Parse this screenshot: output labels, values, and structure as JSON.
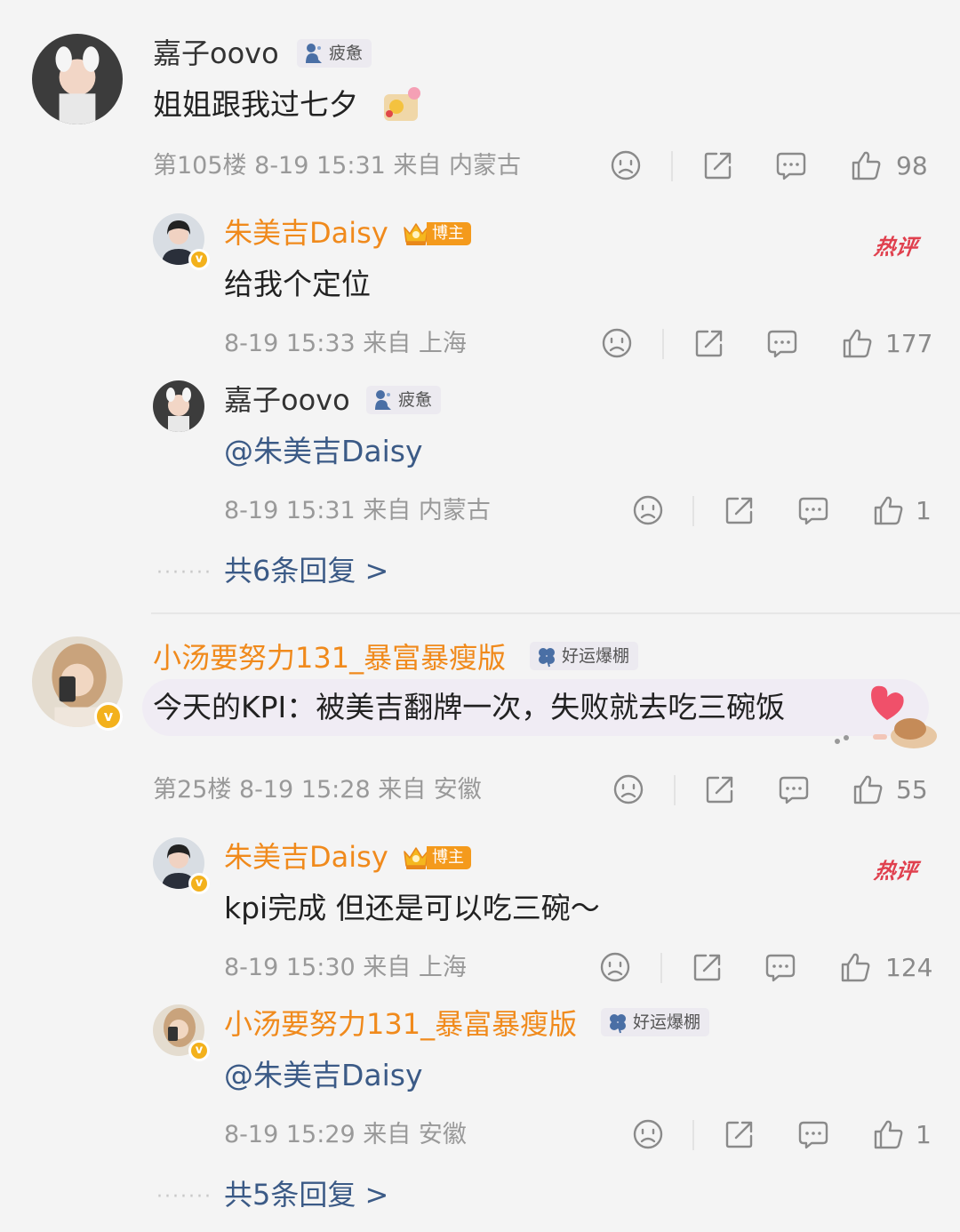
{
  "comments": [
    {
      "user": "嘉子oovo",
      "tag": "疲惫",
      "text": "姐姐跟我过七夕",
      "floor": "第105楼",
      "meta": "8-19 15:31 来自 内蒙古",
      "likes": "98",
      "replies": [
        {
          "user": "朱美吉Daisy",
          "badge": "博主",
          "hot": "热评",
          "text": "给我个定位",
          "meta": "8-19 15:33 来自 上海",
          "likes": "177"
        },
        {
          "user": "嘉子oovo",
          "tag": "疲惫",
          "text": "@朱美吉Daisy",
          "meta": "8-19 15:31 来自 内蒙古",
          "likes": "1"
        }
      ],
      "more": "共6条回复 >"
    },
    {
      "user": "小汤要努力131_暴富暴瘦版",
      "tag": "好运爆棚",
      "text": "今天的KPI：被美吉翻牌一次，失败就去吃三碗饭",
      "floor": "第25楼",
      "meta": "8-19 15:28 来自 安徽",
      "likes": "55",
      "replies": [
        {
          "user": "朱美吉Daisy",
          "badge": "博主",
          "hot": "热评",
          "text": "kpi完成 但还是可以吃三碗～",
          "meta": "8-19 15:30 来自 上海",
          "likes": "124"
        },
        {
          "user": "小汤要努力131_暴富暴瘦版",
          "tag": "好运爆棚",
          "text": "@朱美吉Daisy",
          "meta": "8-19 15:29 来自 安徽",
          "likes": "1"
        }
      ],
      "more": "共5条回复 >"
    }
  ],
  "icons": {
    "dislike": "sad-face-icon",
    "share": "share-icon",
    "comment": "comment-icon",
    "like": "thumbs-up-icon"
  },
  "colors": {
    "username_orange": "#f08a1c",
    "mention_blue": "#3b5a86",
    "hot_red": "#e0404e",
    "verified_gold": "#f3b11c"
  }
}
